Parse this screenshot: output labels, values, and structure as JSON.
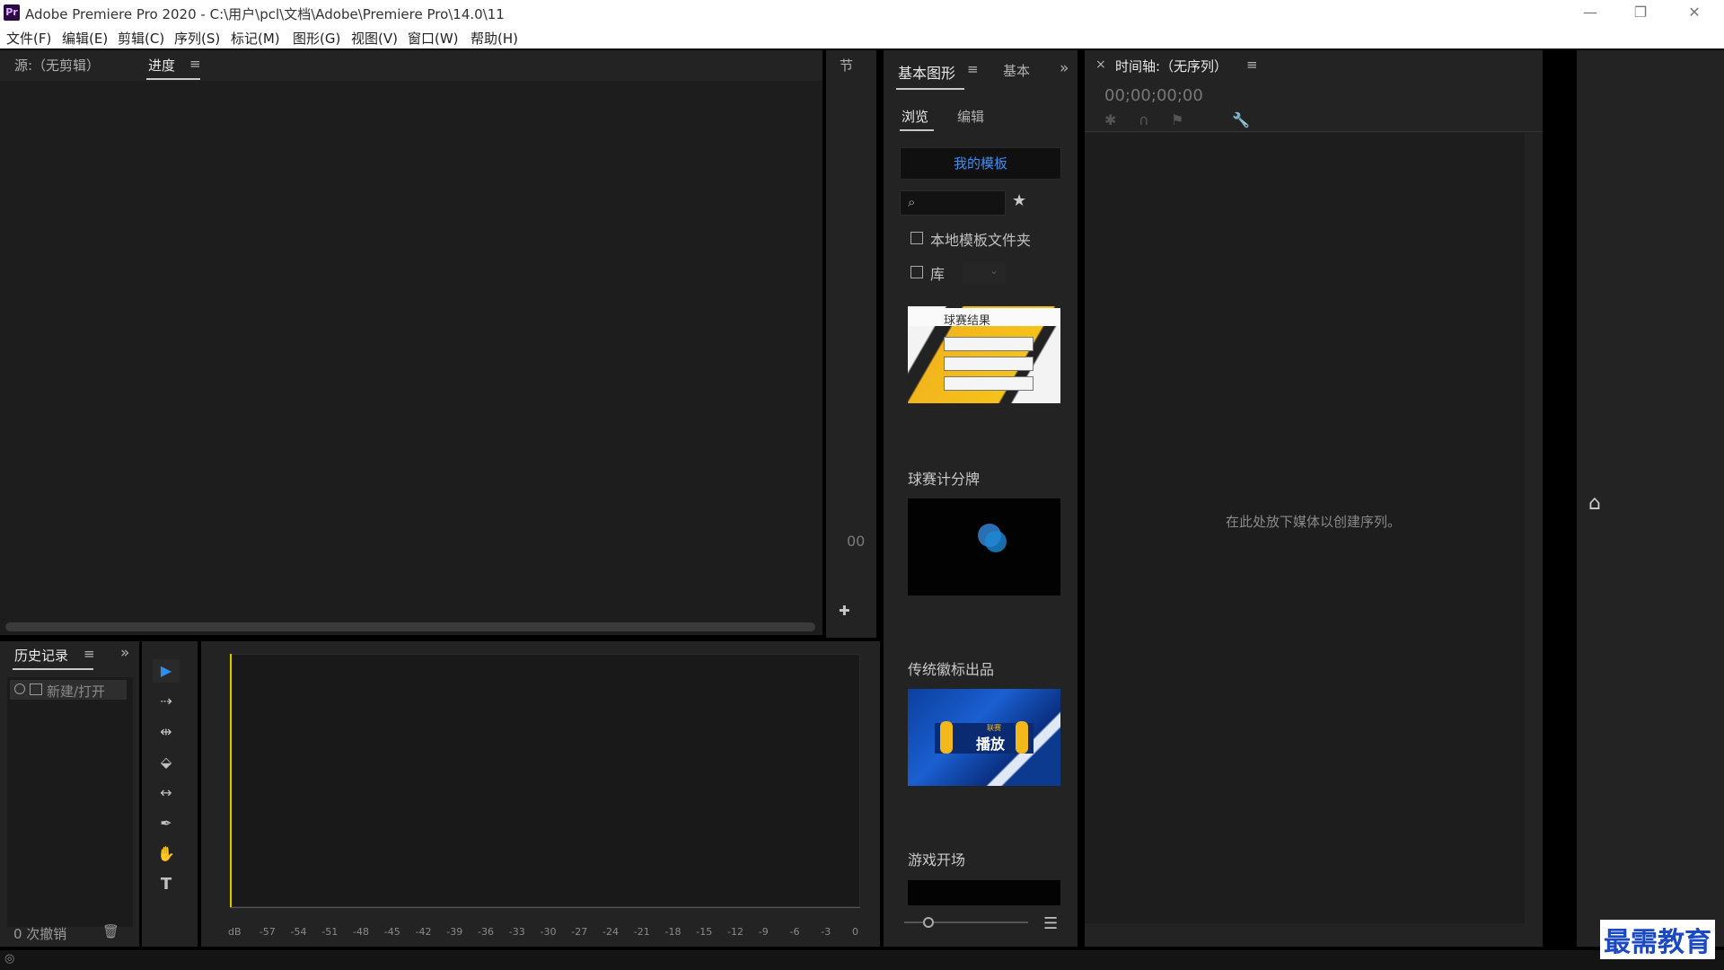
{
  "window": {
    "icon_text": "Pr",
    "title": "Adobe Premiere Pro 2020 - C:\\用户\\pcl\\文档\\Adobe\\Premiere Pro\\14.0\\11",
    "minimize": "—",
    "restore": "❐",
    "close": "✕"
  },
  "menu": [
    "文件(F)",
    "编辑(E)",
    "剪辑(C)",
    "序列(S)",
    "标记(M)",
    "图形(G)",
    "视图(V)",
    "窗口(W)",
    "帮助(H)"
  ],
  "source_panel": {
    "tab_source": "源:（无剪辑）",
    "tab_progress": "进度",
    "menu_icon": "≡"
  },
  "narrow_panel": {
    "tab": "节",
    "value": "00",
    "add": "✚"
  },
  "history": {
    "tab": "历史记录",
    "menu_icon": "≡",
    "expand": "»",
    "item": "新建/打开",
    "undo_count": "0 次撤销"
  },
  "meter": {
    "ticks": [
      "dB",
      "-57",
      "-54",
      "-51",
      "-48",
      "-45",
      "-42",
      "-39",
      "-36",
      "-33",
      "-30",
      "-27",
      "-24",
      "-21",
      "-18",
      "-15",
      "-12",
      "-9",
      "-6",
      "-3",
      "0"
    ]
  },
  "graphics": {
    "tab_main": "基本图形",
    "tab_menu": "≡",
    "tab_second": "基本",
    "expand": "»",
    "tab_browse": "浏览",
    "tab_edit": "编辑",
    "my_templates": "我的模板",
    "local_folder": "本地模板文件夹",
    "library": "库",
    "templates": [
      {
        "label": "",
        "thumb_title": "球赛结果"
      },
      {
        "label": "球赛计分牌"
      },
      {
        "label": "传统徽标出品",
        "thumb_title": "播放",
        "thumb_sub": "联赛"
      },
      {
        "label": "游戏开场"
      }
    ]
  },
  "timeline": {
    "close": "×",
    "tab": "时间轴:（无序列）",
    "menu_icon": "≡",
    "timecode": "00;00;00;00",
    "empty_message": "在此处放下媒体以创建序列。"
  },
  "watermark": "最需教育",
  "colors": {
    "accent_blue": "#2f8df0",
    "playhead_yellow": "#d9c400",
    "panel_bg": "#1d1d1d"
  }
}
